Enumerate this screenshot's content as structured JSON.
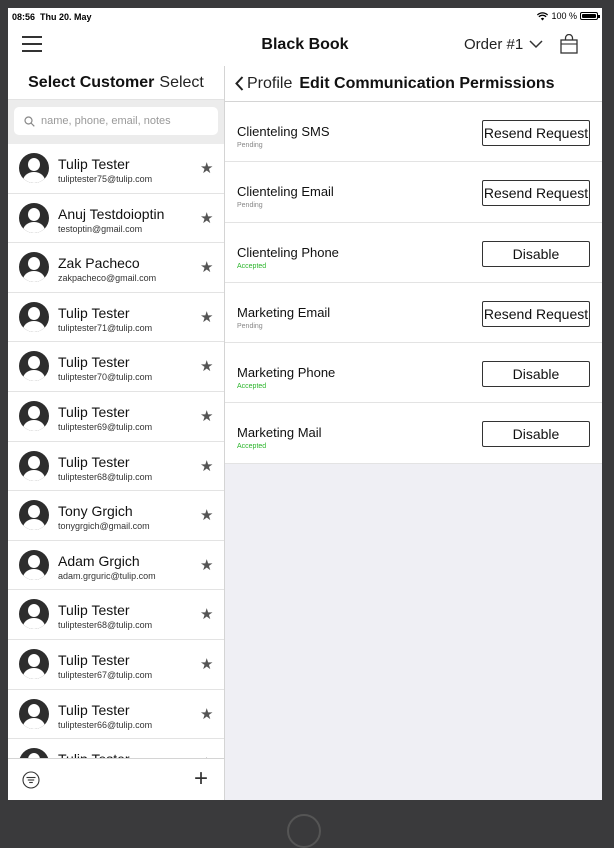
{
  "status_bar": {
    "time": "08:56",
    "date": "Thu 20. May",
    "battery": "100 %"
  },
  "navbar": {
    "title": "Black Book",
    "order_label": "Order #1"
  },
  "left_pane": {
    "title": "Select Customer",
    "select_label": "Select",
    "search_placeholder": "name, phone, email, notes",
    "customers": [
      {
        "name": "Tulip Tester",
        "email": "tuliptester75@tulip.com"
      },
      {
        "name": "Anuj Testdoioptin",
        "email": "testoptin@gmail.com"
      },
      {
        "name": "Zak Pacheco",
        "email": "zakpacheco@gmail.com"
      },
      {
        "name": "Tulip Tester",
        "email": "tuliptester71@tulip.com"
      },
      {
        "name": "Tulip Tester",
        "email": "tuliptester70@tulip.com"
      },
      {
        "name": "Tulip Tester",
        "email": "tuliptester69@tulip.com"
      },
      {
        "name": "Tulip Tester",
        "email": "tuliptester68@tulip.com"
      },
      {
        "name": "Tony Grgich",
        "email": "tonygrgich@gmail.com"
      },
      {
        "name": "Adam Grgich",
        "email": "adam.grguric@tulip.com"
      },
      {
        "name": "Tulip Tester",
        "email": "tuliptester68@tulip.com"
      },
      {
        "name": "Tulip Tester",
        "email": "tuliptester67@tulip.com"
      },
      {
        "name": "Tulip Tester",
        "email": "tuliptester66@tulip.com"
      },
      {
        "name": "Tulip Tester",
        "email": ""
      }
    ]
  },
  "right_pane": {
    "back_label": "Profile",
    "title": "Edit Communication Permissions",
    "permissions": [
      {
        "name": "Clienteling SMS",
        "status": "Pending",
        "action": "Resend Request"
      },
      {
        "name": "Clienteling Email",
        "status": "Pending",
        "action": "Resend Request"
      },
      {
        "name": "Clienteling Phone",
        "status": "Accepted",
        "action": "Disable"
      },
      {
        "name": "Marketing Email",
        "status": "Pending",
        "action": "Resend Request"
      },
      {
        "name": "Marketing Phone",
        "status": "Accepted",
        "action": "Disable"
      },
      {
        "name": "Marketing Mail",
        "status": "Accepted",
        "action": "Disable"
      }
    ]
  },
  "colors": {
    "accepted": "#2bb52b",
    "pending": "#888888",
    "frame": "#3a3a3c"
  }
}
